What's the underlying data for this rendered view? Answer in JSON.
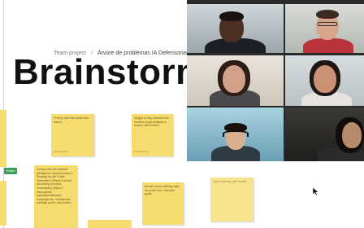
{
  "breadcrumb": {
    "project": "Team project",
    "board": "Árvore de problemas IA Defensorias"
  },
  "board_title": "Brainstorm",
  "stickies": [
    {
      "text": "Privacy and data protection issues",
      "author": "Lorem ipsum"
    },
    {
      "text": "Stages of any process that involves legal analysis or human intervention",
      "author": "Lorem ipsum"
    },
    {
      "text": "comply with the Artificial Intelligence Implementation Strategy by the Public Defender's Offices in Brazil. According to public consultation (https:// www.gov.br/ participamaisbrasil/ estrategia-de- inteligencia-artificial) public information",
      "author": ""
    },
    {
      "text": "private actors utilizing data for profit/ non- intended goals",
      "author": ""
    },
    {
      "text": "Type anything, get results...",
      "author": ""
    }
  ],
  "green_tab": "Notes",
  "colors": {
    "sticky": "#f6dc6f",
    "accent_green": "#3f9e5a"
  }
}
